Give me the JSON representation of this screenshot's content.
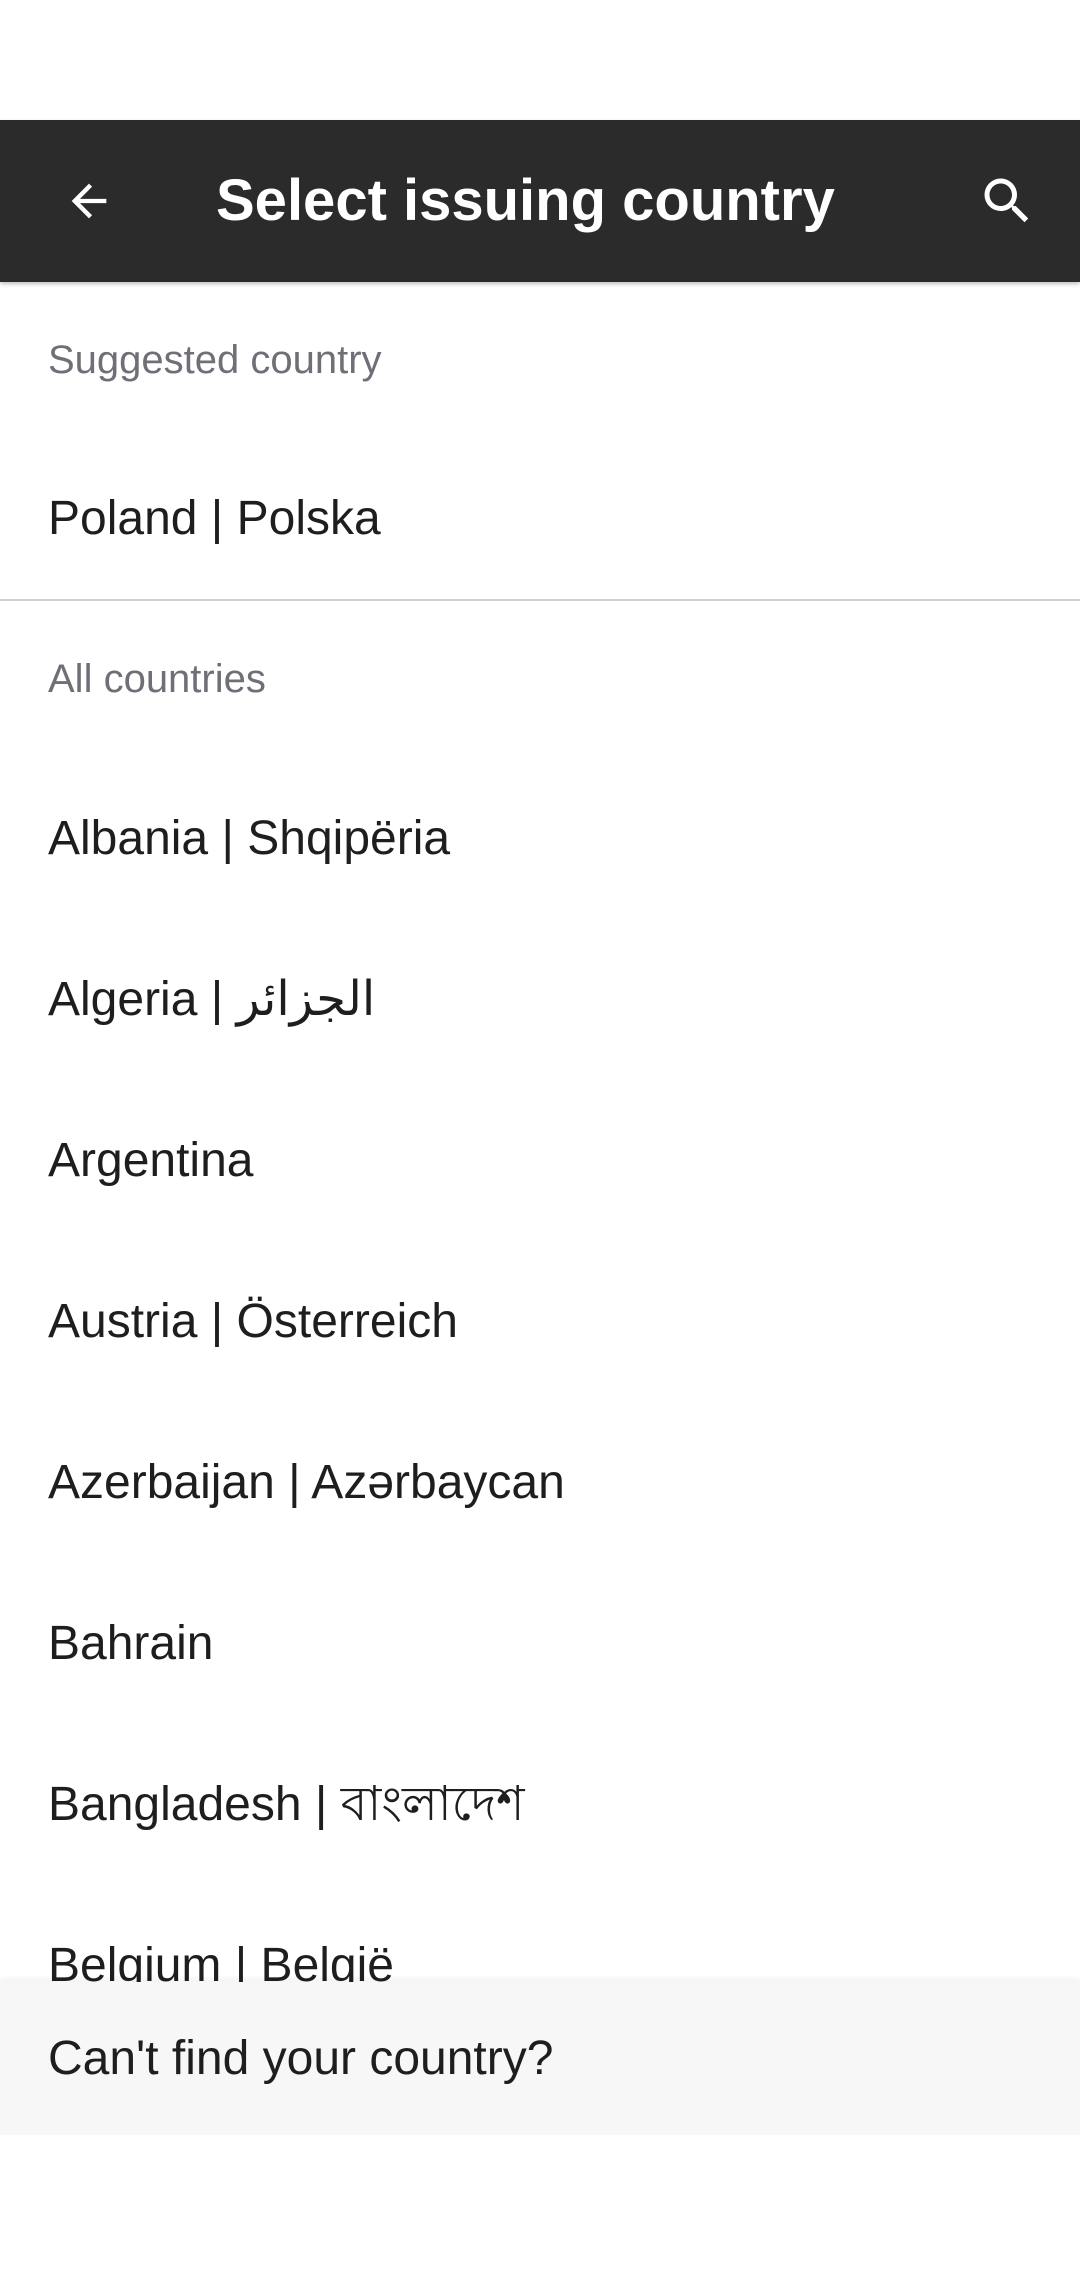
{
  "app_bar": {
    "title": "Select issuing country",
    "back_icon": "arrow-back-icon",
    "search_icon": "search-icon",
    "background": "#2b2b2b"
  },
  "suggested": {
    "header": "Suggested country",
    "items": [
      {
        "label": "Poland | Polska"
      }
    ]
  },
  "all": {
    "header": "All countries",
    "items": [
      {
        "label": "Albania | Shqipëria"
      },
      {
        "label": "Algeria | الجزائر"
      },
      {
        "label": "Argentina"
      },
      {
        "label": "Austria | Österreich"
      },
      {
        "label": "Azerbaijan | Azərbaycan"
      },
      {
        "label": "Bahrain"
      },
      {
        "label": "Bangladesh | বাংলাদেশ"
      },
      {
        "label": "Belgium | België"
      }
    ]
  },
  "footer": {
    "link_text": "Can't find your country?"
  }
}
